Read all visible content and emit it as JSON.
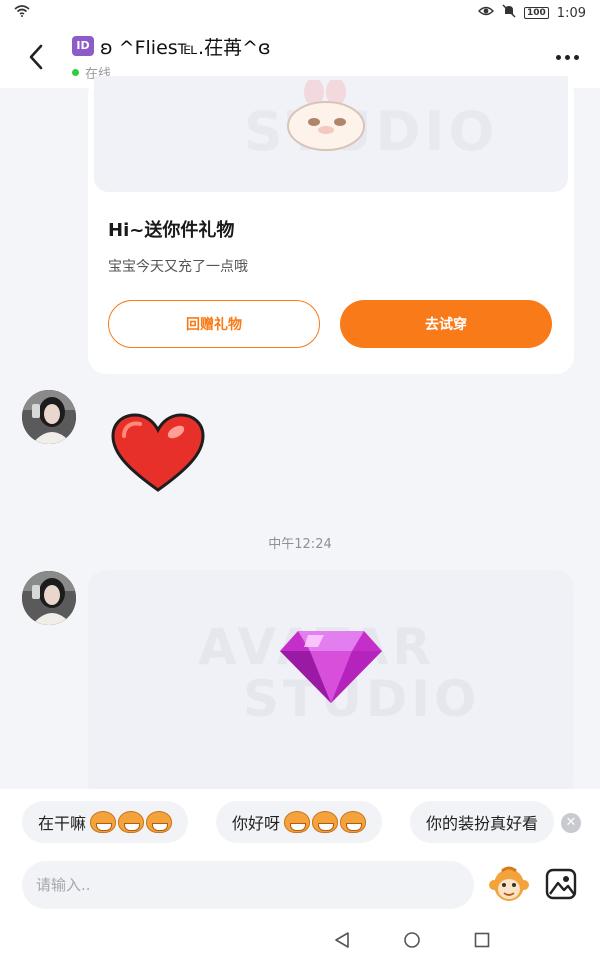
{
  "status_bar": {
    "time": "1:09",
    "battery": "100",
    "icons": [
      "wifi-icon",
      "eye-icon",
      "mute-icon",
      "battery-icon"
    ]
  },
  "header": {
    "id_badge": "ID",
    "title": "ʚ ^Flies℡.茌苒^ɞ",
    "status": "在线",
    "icons": [
      "back-arrow-icon",
      "more-dots-icon"
    ]
  },
  "gift_card": {
    "title": "Hi~送你件礼物",
    "subtitle": "宝宝今天又充了一点哦",
    "button_return": "回赠礼物",
    "button_try": "去试穿",
    "watermark": "STUDIO"
  },
  "chat": {
    "timestamp": "中午12:24",
    "sticker_1": "heart-sticker",
    "sticker_2": "gem-sticker",
    "watermark_top": "AVATAR",
    "watermark_bottom": "STUDIO"
  },
  "quick_replies": [
    {
      "text": "在干嘛"
    },
    {
      "text": "你好呀"
    },
    {
      "text": "你的装扮真好看"
    }
  ],
  "input": {
    "placeholder": "请输入..",
    "value": ""
  },
  "colors": {
    "accent": "#f97a18",
    "online": "#2ecc40",
    "background": "#f4f5f9"
  }
}
